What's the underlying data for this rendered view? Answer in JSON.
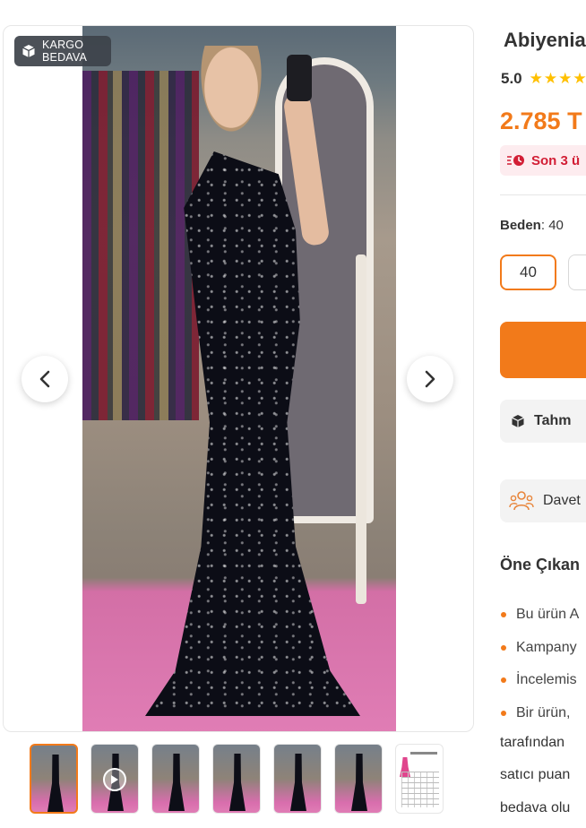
{
  "gallery": {
    "badge_line1": "KARGO",
    "badge_line2": "BEDAVA",
    "thumbnails": [
      {
        "type": "photo",
        "active": true
      },
      {
        "type": "video",
        "active": false
      },
      {
        "type": "photo",
        "active": false
      },
      {
        "type": "photo",
        "active": false
      },
      {
        "type": "photo",
        "active": false
      },
      {
        "type": "photo",
        "active": false
      },
      {
        "type": "size-chart",
        "active": false
      }
    ]
  },
  "product": {
    "title": "Abiyenia",
    "rating": "5.0",
    "stars": 5,
    "price": "2.785 T",
    "alert_text": "Son 3 ü",
    "size_label": "Beden",
    "size_value": "40",
    "sizes": [
      "40",
      ""
    ]
  },
  "shipping": {
    "label": "Tahm"
  },
  "invite": {
    "label": "Davet"
  },
  "features": {
    "title": "Öne Çıkan",
    "items": [
      "Bu ürün A",
      "Kampany",
      "İncelemis",
      "Bir ürün,"
    ],
    "continuation": [
      "tarafından",
      "satıcı puan",
      "bedava olu"
    ]
  },
  "colors": {
    "accent": "#f27a1a",
    "alert_red": "#d21e35",
    "star": "#ffc000"
  }
}
